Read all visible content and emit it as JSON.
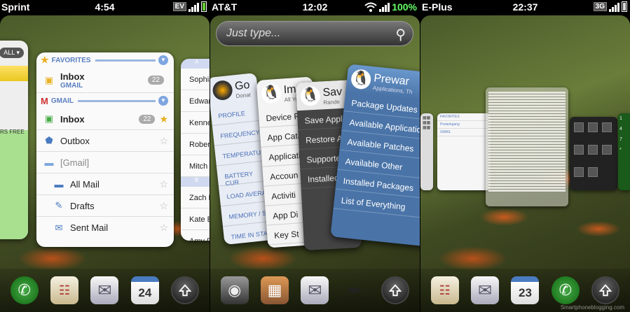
{
  "phone1": {
    "carrier": "Sprint",
    "time": "4:54",
    "network_badge": "EV",
    "left_card": {
      "all_button": "ALL ▾",
      "green_text": "RS FREE"
    },
    "mail": {
      "favorites_header": "FAVORITES",
      "inbox_fav": {
        "label": "Inbox",
        "sub": "GMAIL",
        "count": "22"
      },
      "gmail_header": "GMAIL",
      "inbox": {
        "label": "Inbox",
        "count": "22"
      },
      "outbox": "Outbox",
      "gmail_folder": "[Gmail]",
      "all_mail": "All Mail",
      "drafts": "Drafts",
      "sent_mail": "Sent Mail"
    },
    "contacts": {
      "letter_a": "A",
      "letter_b": "B",
      "names": [
        "Sophia",
        "Edward",
        "Kenne",
        "Rober",
        "Mitch"
      ],
      "names_b": [
        "Zach E",
        "Kate E",
        "Amy F"
      ]
    },
    "dock": {
      "calendar_day": "24"
    }
  },
  "phone2": {
    "carrier": "AT&T",
    "time": "12:02",
    "battery": "100%",
    "search_placeholder": "Just type...",
    "card1": {
      "title": "Go",
      "sub": "Donat",
      "items": [
        "PROFILE",
        "FREQUENCY",
        "TEMPERATURE",
        "BATTERY CUR",
        "LOAD AVERA",
        "MEMORY / S",
        "TIME IN STA"
      ]
    },
    "card2": {
      "title": "Im",
      "sub": "All Yo",
      "items": [
        "Device Pro",
        "App Catal",
        "Applicatio",
        "Accoun",
        "Activiti",
        "App Di",
        "Key St"
      ]
    },
    "card3": {
      "title": "Sav",
      "sub": "Rande",
      "items": [
        "Save Applic",
        "Restore Ap",
        "Supported",
        "Installed A"
      ]
    },
    "card4": {
      "title": "Prewar",
      "sub": "Applications, Th",
      "items": [
        "Package Updates",
        "Available Application",
        "Available Patches",
        "Available Other",
        "Installed Packages",
        "List of Everything"
      ]
    }
  },
  "phone3": {
    "carrier": "E-Plus",
    "time": "22:37",
    "network_badge": "3G",
    "mini_email": {
      "rows": [
        "FAVORITES",
        "Posteingang",
        "GMAIL"
      ]
    },
    "right_card_digits": [
      "1",
      "4",
      "7",
      "*"
    ],
    "dock": {
      "calendar_day": "23"
    },
    "watermark": "Smartphoneblogging.com"
  }
}
